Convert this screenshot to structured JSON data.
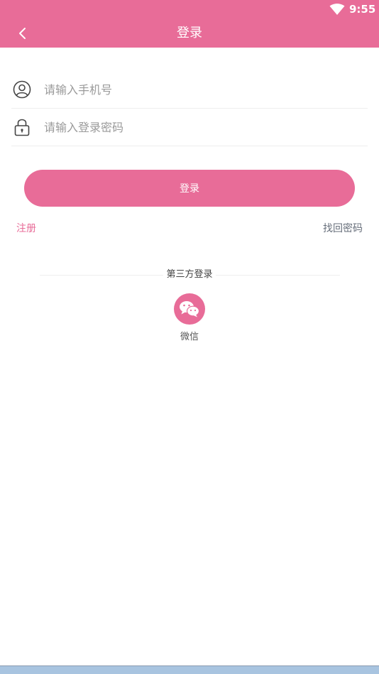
{
  "status_bar": {
    "time": "9:55"
  },
  "app_bar": {
    "title": "登录"
  },
  "form": {
    "phone_placeholder": "请输入手机号",
    "password_placeholder": "请输入登录密码"
  },
  "actions": {
    "login_label": "登录",
    "register_label": "注册",
    "forgot_label": "找回密码"
  },
  "third_party": {
    "title": "第三方登录",
    "wechat_label": "微信"
  },
  "colors": {
    "accent": "#e86c98",
    "placeholder": "#9a9a9a",
    "secondary_link": "#666e7a"
  },
  "icons": {
    "back": "chevron-left-icon",
    "phone": "user-circle-icon",
    "password": "lock-icon",
    "wechat": "wechat-icon",
    "wifi": "wifi-icon"
  }
}
